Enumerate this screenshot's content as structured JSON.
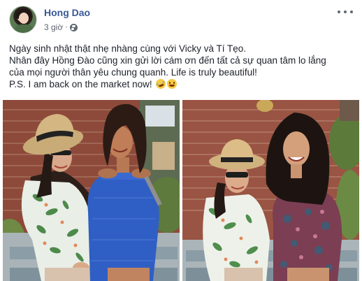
{
  "post": {
    "author_name": "Hong Dao",
    "timestamp": "3 giờ",
    "separator": "·",
    "privacy_icon": "globe-icon",
    "menu_icon": "more-options-icon",
    "text_lines": [
      "Ngày sinh nhật thật nhẹ nhàng cùng với Vicky và Tí Tẹo.",
      "Nhân đây Hồng Đào cũng xin gửi lời cám ơn đến tất cả sự quan tâm lo lắng",
      "của mọi người thân yêu chung quanh. Life is truly beautiful!",
      "P.S. I am back on the market now!"
    ],
    "emojis": [
      "rolling-on-floor-laughing-emoji",
      "grinning-squinting-emoji"
    ]
  },
  "photos": [
    {
      "description_name": "photo-women-seated-left"
    },
    {
      "description_name": "photo-women-seated-right"
    }
  ]
}
